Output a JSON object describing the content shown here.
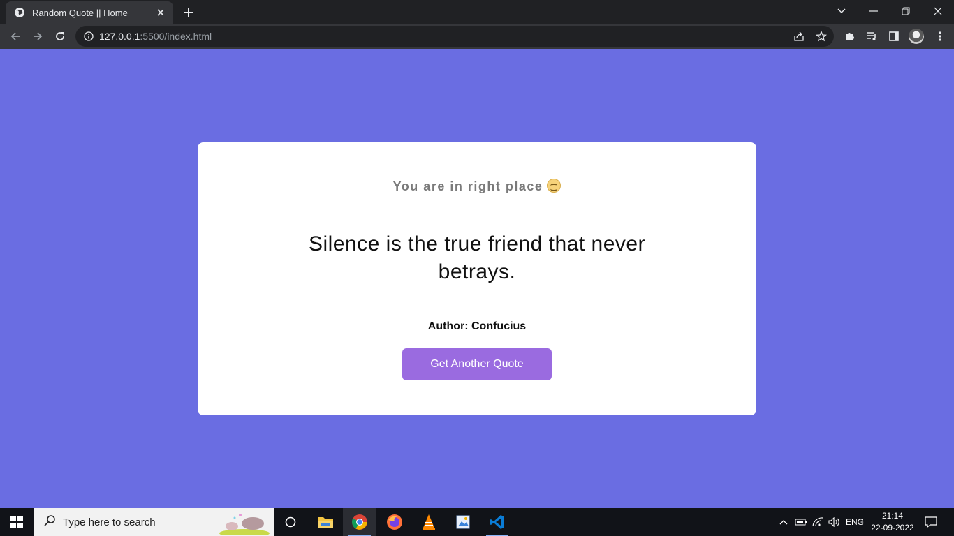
{
  "browser": {
    "tab_title": "Random Quote || Home",
    "url_host": "127.0.0.1",
    "url_rest": ":5500/index.html"
  },
  "page": {
    "greeting": "You are in right place",
    "quote": "Silence is the true friend that never betrays.",
    "author": "Author: Confucius",
    "button_label": "Get Another Quote",
    "colors": {
      "background": "#6a6de2",
      "card": "#ffffff",
      "button": "#9a6be0",
      "greeting_text": "#7a7a7a"
    }
  },
  "taskbar": {
    "search_placeholder": "Type here to search",
    "language": "ENG",
    "time": "21:14",
    "date": "22-09-2022",
    "pinned_apps": [
      "file-explorer",
      "chrome",
      "firefox",
      "vlc",
      "image-editor",
      "vscode"
    ]
  }
}
